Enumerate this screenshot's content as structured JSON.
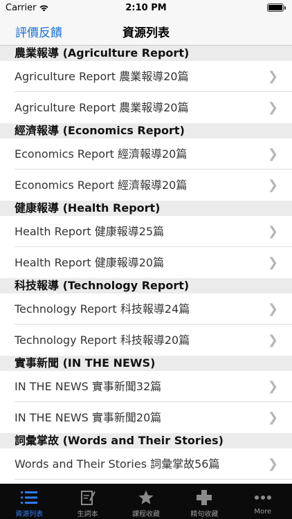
{
  "status": {
    "carrier": "Carrier",
    "time": "2:10 PM"
  },
  "nav": {
    "left_button": "評價反饋",
    "title": "資源列表"
  },
  "sections": [
    {
      "header": "農業報導 (Agriculture Report)",
      "rows": [
        "Agriculture Report 農業報導20篇",
        "Agriculture Report 農業報導20篇"
      ]
    },
    {
      "header": "經濟報導 (Economics Report)",
      "rows": [
        "Economics Report 經濟報導20篇",
        "Economics Report 經濟報導20篇"
      ]
    },
    {
      "header": "健康報導 (Health Report)",
      "rows": [
        "Health Report 健康報導25篇",
        "Health Report 健康報導20篇"
      ]
    },
    {
      "header": "科技報導 (Technology Report)",
      "rows": [
        "Technology Report 科技報導24篇",
        "Technology Report 科技報導20篇"
      ]
    },
    {
      "header": "實事新聞 (IN THE NEWS)",
      "rows": [
        "IN THE NEWS 實事新聞32篇",
        "IN THE NEWS 實事新聞20篇"
      ]
    },
    {
      "header": "詞彙掌故 (Words and Their Stories)",
      "rows": [
        "Words and Their Stories 詞彙掌故56篇"
      ]
    }
  ],
  "tabs": [
    {
      "label": "資源列表",
      "icon": "list-icon"
    },
    {
      "label": "生詞本",
      "icon": "notebook-icon"
    },
    {
      "label": "課程收藏",
      "icon": "star-icon"
    },
    {
      "label": "精句收藏",
      "icon": "plus-icon"
    },
    {
      "label": "More",
      "icon": "more-icon"
    }
  ],
  "colors": {
    "accent": "#1a6ed8",
    "tab_active": "#2f7cf6",
    "tab_inactive": "#9b9b9b",
    "tab_bar_bg": "#0b0b0b"
  }
}
